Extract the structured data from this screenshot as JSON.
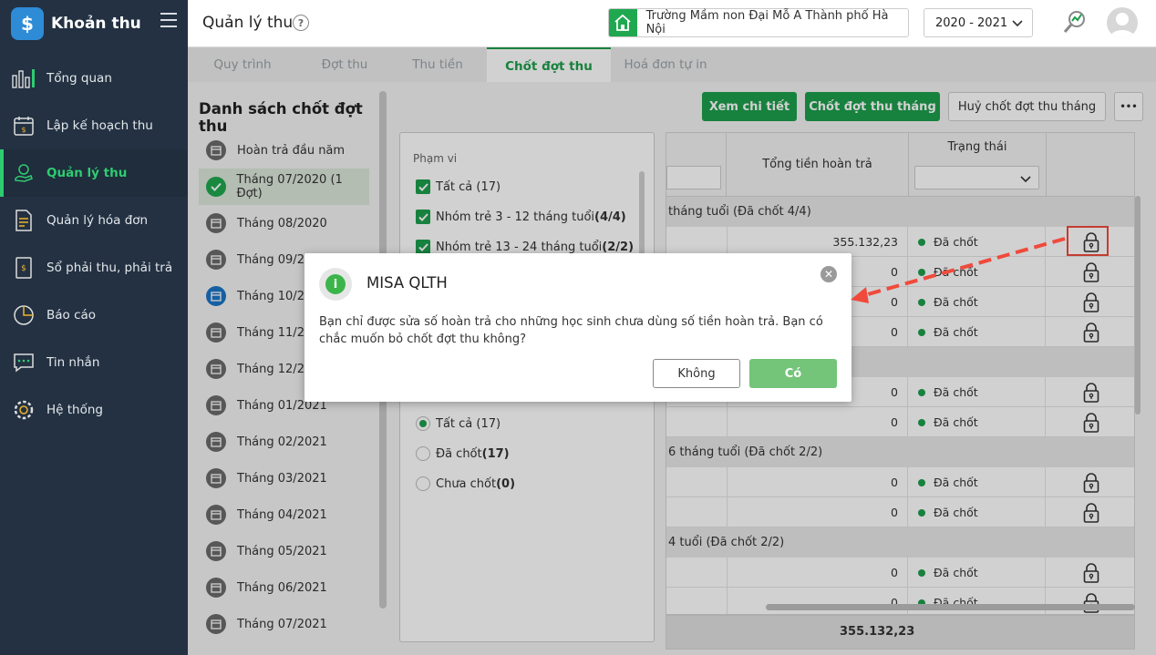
{
  "app": {
    "logo_glyph": "$",
    "name": "Khoản thu"
  },
  "nav": [
    {
      "label": "Tổng quan",
      "icon": "chart-bars-icon"
    },
    {
      "label": "Lập kế hoạch thu",
      "icon": "calendar-money-icon"
    },
    {
      "label": "Quản lý thu",
      "icon": "hand-coin-icon",
      "active": true
    },
    {
      "label": "Quản lý hóa đơn",
      "icon": "invoice-icon"
    },
    {
      "label": "Sổ phải thu, phải trả",
      "icon": "ledger-book-icon"
    },
    {
      "label": "Báo cáo",
      "icon": "pie-chart-icon"
    },
    {
      "label": "Tin nhắn",
      "icon": "chat-icon"
    },
    {
      "label": "Hệ thống",
      "icon": "gear-icon"
    }
  ],
  "header": {
    "title": "Quản lý thu",
    "help_glyph": "?",
    "school": "Trường Mầm non Đại Mỗ A Thành phố Hà Nội",
    "year": "2020 - 2021"
  },
  "tabs": [
    "Quy trình",
    "Đợt thu",
    "Thu tiền",
    "Chốt đợt thu",
    "Hoá đơn tự in"
  ],
  "active_tab": 3,
  "list": {
    "title": "Danh sách chốt đợt thu",
    "items": [
      "Hoàn trả đầu năm",
      "Tháng 07/2020 (1 Đợt)",
      "Tháng 08/2020",
      "Tháng 09/20",
      "Tháng 10/20",
      "Tháng 11/20",
      "Tháng 12/20",
      "Tháng 01/2021",
      "Tháng 02/2021",
      "Tháng 03/2021",
      "Tháng 04/2021",
      "Tháng 05/2021",
      "Tháng 06/2021",
      "Tháng 07/2021"
    ]
  },
  "actions": {
    "view": "Xem chi tiết",
    "close": "Chốt đợt thu tháng",
    "cancel": "Huỷ chốt đợt thu tháng",
    "more": "•••"
  },
  "filter": {
    "scope_label": "Phạm vi",
    "scope": [
      {
        "text": "Tất cả (17)",
        "bold": ""
      },
      {
        "text": "Nhóm trẻ 3 - 12 tháng tuổi ",
        "bold": "(4/4)"
      },
      {
        "text": "Nhóm trẻ 13 - 24 tháng tuổi ",
        "bold": "(2/2)"
      }
    ],
    "status": [
      {
        "text": "Tất cả (17)",
        "bold": ""
      },
      {
        "text": "Đã chốt ",
        "bold": "(17)"
      },
      {
        "text": "Chưa chốt ",
        "bold": "(0)"
      }
    ]
  },
  "grid": {
    "col_total": "Tổng tiền hoàn trả",
    "col_status": "Trạng thái",
    "groups": [
      {
        "label": "tháng tuổi (Đã chốt 4/4)",
        "rows": [
          "355.132,23",
          "0",
          "0",
          "0"
        ]
      },
      {
        "label": "",
        "rows": [
          "0",
          "0"
        ]
      },
      {
        "label": "6 tháng tuổi (Đã chốt 2/2)",
        "rows": [
          "0",
          "0"
        ]
      },
      {
        "label": "4 tuổi (Đã chốt 2/2)",
        "rows": [
          "0",
          "0"
        ]
      }
    ],
    "status_text": "Đã chốt",
    "footer_total": "355.132,23"
  },
  "dialog": {
    "icon_glyph": "i",
    "title": "MISA QLTH",
    "message": "Bạn chỉ được sửa số hoàn trả cho những học sinh chưa dùng số tiền hoàn trả. Bạn có chắc muốn bỏ chốt đợt thu không?",
    "close_glyph": "✕",
    "no": "Không",
    "yes": "Có"
  },
  "colors": {
    "accent": "#1d9e4c",
    "sidebar": "#233142",
    "annotation": "#f04a3c"
  }
}
